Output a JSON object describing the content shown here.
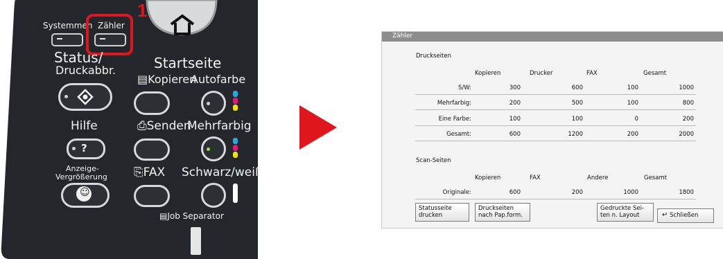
{
  "panel": {
    "keys": {
      "systemmenu": "Systemmen",
      "counter": "Zähler",
      "callout_number": "1",
      "status_line1": "Status/",
      "status_line2": "Druckabbr.",
      "home": "Startseite",
      "copy": "Kopieren",
      "autocolor": "Autofarbe",
      "help": "Hilfe",
      "help_symbol": "?",
      "send": "Senden",
      "fullcolor": "Mehrfarbig",
      "zoom_line1": "Anzeige-",
      "zoom_line2": "Vergrößerung",
      "fax": "FAX",
      "blackwhite": "Schwarz/weiß",
      "job_separator": "Job Separator"
    },
    "callout_color": "#e0161d"
  },
  "screen": {
    "title": "Zähler",
    "print_section": {
      "heading": "Druckseiten",
      "columns": [
        "Kopieren",
        "Drucker",
        "FAX",
        "Gesamt"
      ],
      "rows": [
        {
          "label": "S/W:",
          "values": [
            "300",
            "600",
            "100",
            "1000"
          ]
        },
        {
          "label": "Mehrfarbig:",
          "values": [
            "200",
            "500",
            "100",
            "800"
          ]
        },
        {
          "label": "Eine Farbe:",
          "values": [
            "100",
            "100",
            "0",
            "200"
          ]
        },
        {
          "label": "Gesamt:",
          "values": [
            "600",
            "1200",
            "200",
            "2000"
          ]
        }
      ]
    },
    "scan_section": {
      "heading": "Scan-Seiten",
      "columns": [
        "Kopieren",
        "FAX",
        "Andere",
        "Gesamt"
      ],
      "rows": [
        {
          "label": "Originale:",
          "values": [
            "600",
            "200",
            "1000",
            "1800"
          ]
        }
      ]
    },
    "buttons": {
      "status_page_line1": "Statusseite",
      "status_page_line2": "drucken",
      "by_paper_line1": "Druckseiten",
      "by_paper_line2": "nach Pap.form.",
      "by_layout_line1": "Gedruckte Sei-",
      "by_layout_line2": "ten n. Layout",
      "close": "Schließen"
    }
  },
  "colors": {
    "panel_dark": "#1f2327",
    "arrow_red": "#e0161d",
    "titlebar_gray": "#8d8d8d"
  }
}
